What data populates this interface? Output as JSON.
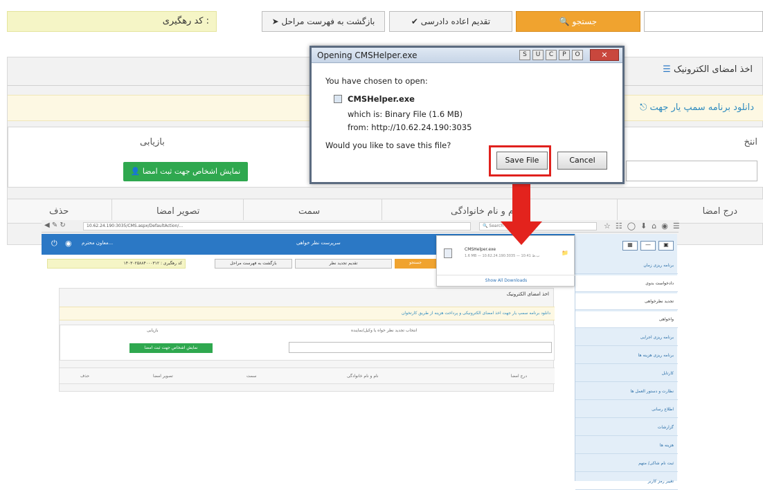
{
  "toolbar": {
    "search_label": "جستجو",
    "submit_label": "تقديم اعاده دادرسی",
    "back_label": "بازگشت به فهرست مراحل",
    "tracking_label": "کد رهگیری :"
  },
  "panel": {
    "title": "اخذ امضای الکترونیک",
    "notice": "دانلود برنامه سمپ یار جهت",
    "col_retrieve": "بازیابی",
    "col_select": "انتخ",
    "green_button": "نمایش اشخاص جهت ثبت امضا",
    "columns": [
      "درج امضا",
      "نام و نام خانوادگی",
      "سمت",
      "تصویر امضا",
      "حذف"
    ]
  },
  "dialog": {
    "title": "Opening CMSHelper.exe",
    "titlebar_buttons": [
      "S",
      "U",
      "C",
      "P",
      "O"
    ],
    "intro": "You have chosen to open:",
    "filename": "CMSHelper.exe",
    "which_is": "which is: Binary File (1.6 MB)",
    "from": "from: http://10.62.24.190:3035",
    "question": "Would you like to save this file?",
    "save_label": "Save File",
    "cancel_label": "Cancel"
  },
  "browser": {
    "address": "10.62.24.190:3035/CMS.aspx/DefaultAction/...",
    "search_placeholder": "Search",
    "header_left": "معاون محترم...",
    "header_center": "سرپرست نظر خواهی",
    "tracking": "کد رهگیری : ۱۴۰۳۰۲۵۸۸۴۰۰۰۳۱۲",
    "back": "بازگشت به فهرست مراحل",
    "submit": "تقدیم تجدید نظر",
    "search_btn": "جستجو",
    "panel_title": "اخذ امضای الکترونیک",
    "panel_notice": "دانلود برنامه سمپ یار جهت اخذ امضای الکترونیکی و پرداخت هزینه از طریق کارتخوان",
    "panel_retrieve": "بازیابی",
    "panel_select": "انتخاب تجدید نظر خواه یا وکیل/نماینده",
    "panel_button": "نمایش اشخاص جهت ثبت امضا",
    "panel_columns": [
      "درج امضا",
      "نام و نام خانوادگی",
      "سمت",
      "تصویر امضا",
      "حذف"
    ]
  },
  "downloads": {
    "filename": "CMSHelper.exe",
    "meta": "1.6 MB — 10.62.24.190:3035 — 10:41 ب.ظ",
    "show_all": "Show All Downloads"
  },
  "side_menu": [
    "برنامه ریزی زمان",
    "دادخواست بدوی",
    "تجدید نظرخواهی",
    "واخواهی",
    "برنامه ریزی اجرایی",
    "برنامه ریزی هزینه ها",
    "کارتابل",
    "نظارت و دستور العمل ها",
    "اطلاع رسانی",
    "گزارشات",
    "هزینه ها",
    "ثبت نام شاکی/ متهم",
    "تغییر رمز کاربر"
  ]
}
